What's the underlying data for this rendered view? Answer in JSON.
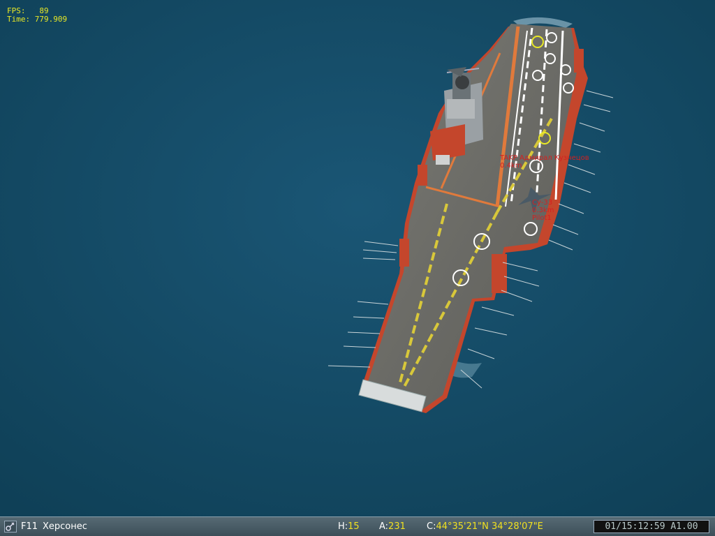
{
  "hud": {
    "fps_label": "FPS:",
    "fps_value": "89",
    "time_label": "Time:",
    "time_value": "779.909"
  },
  "labels": {
    "carrier_name": "TAKP Адмирал Кузнецов",
    "carrier_distance": "0.4km",
    "aircraft_name": "Су-33",
    "aircraft_distance": "0.3km",
    "aircraft_pilot": "Pilot1"
  },
  "status_bar": {
    "view_key": "F11",
    "view_name": "Херсонес",
    "heading_label": "H:",
    "heading_value": "15",
    "altitude_label": "A:",
    "altitude_value": "231",
    "coords_label": "C:",
    "coords_value": "44°35'21\"N 34°28'07\"E",
    "clock": "01/15:12:59 A1.00"
  },
  "colors": {
    "sea": "#134a66",
    "hud_text": "#e8e826",
    "label_text": "#d42020",
    "deck": "#6c6c68",
    "hull_red": "#c4462c"
  },
  "icons": [
    "camera-view-icon"
  ]
}
